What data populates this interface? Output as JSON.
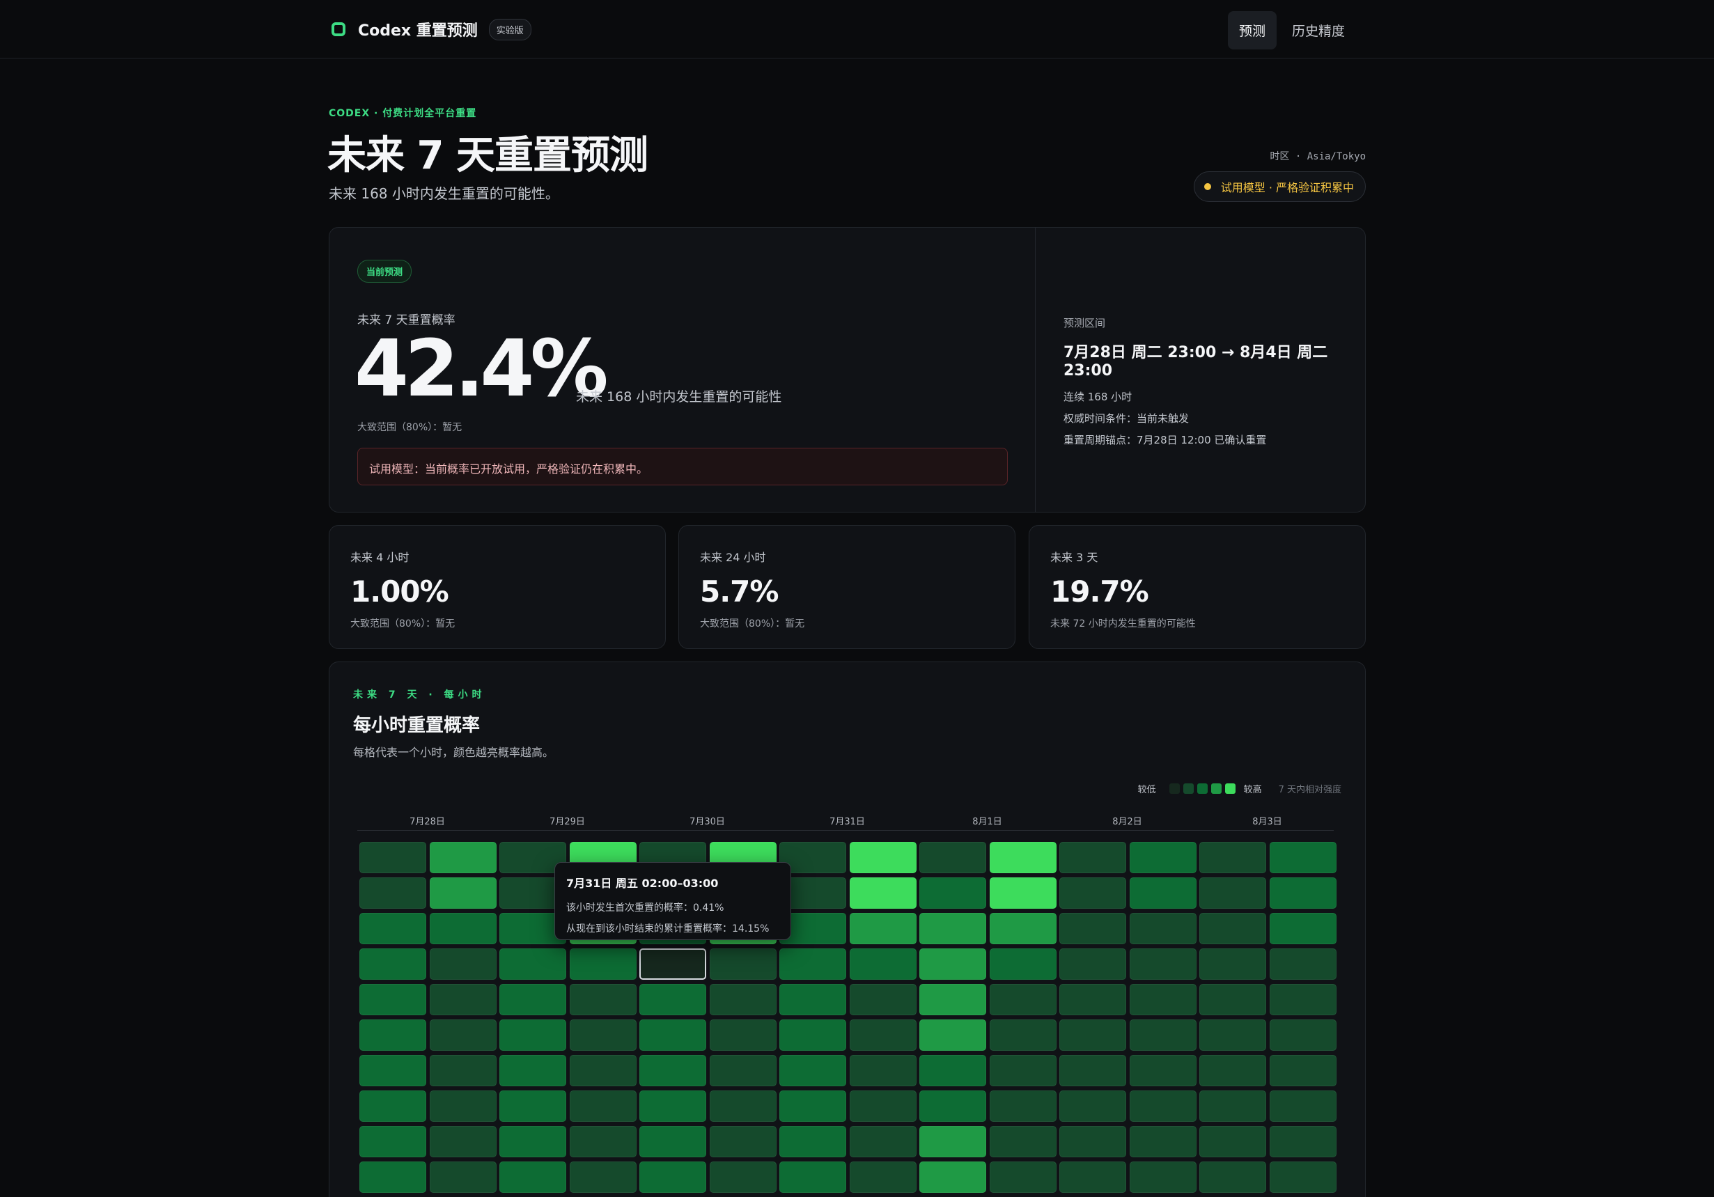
{
  "nav": {
    "brand": "Codex 重置预测",
    "badge": "实验版",
    "links": [
      "预测",
      "历史精度"
    ]
  },
  "header": {
    "eyebrow": "CODEX · 付费计划全平台重置",
    "title": "未来 7 天重置预测",
    "subtitle": "未来 168 小时内发生重置的可能性。",
    "timezone": "时区 · Asia/Tokyo",
    "status": "试用模型 · 严格验证积累中"
  },
  "main": {
    "tag": "当前预测",
    "label": "未来 7 天重置概率",
    "value": "42.4%",
    "note": "未来 168 小时内发生重置的可能性",
    "range": "大致范围（80%）：暂无",
    "warning": "试用模型：当前概率已开放试用，严格验证仍在积累中。",
    "side": {
      "label": "预测区间",
      "range": "7月28日 周二 23:00 → 8月4日 周二 23:00",
      "duration": "连续 168 小时",
      "condition": "权威时间条件：当前未触发",
      "anchor": "重置周期锚点：7月28日 12:00 已确认重置"
    }
  },
  "minis": [
    {
      "label": "未来 4 小时",
      "value": "1.00%",
      "note": "大致范围（80%）：暂无"
    },
    {
      "label": "未来 24 小时",
      "value": "5.7%",
      "note": "大致范围（80%）：暂无"
    },
    {
      "label": "未来 3 天",
      "value": "19.7%",
      "note": "未来 72 小时内发生重置的可能性"
    }
  ],
  "heatmap": {
    "eyebrow": "未来 7 天 · 每小时",
    "title": "每小时重置概率",
    "subtitle": "每格代表一个小时，颜色越亮概率越高。",
    "legend_low": "较低",
    "legend_high": "较高",
    "legend_note": "7 天内相对强度",
    "legend_colors": [
      "#16281e",
      "#154a2c",
      "#0d6c34",
      "#1f9a45",
      "#3ddc5c"
    ],
    "days": [
      "7月28日",
      "7月29日",
      "7月30日",
      "7月31日",
      "8月1日",
      "8月2日",
      "8月3日"
    ],
    "levels": [
      [
        1,
        3,
        1,
        4,
        1,
        4,
        1,
        4,
        1,
        4,
        1,
        2,
        1,
        2
      ],
      [
        1,
        3,
        1,
        4,
        1,
        4,
        1,
        4,
        2,
        4,
        1,
        2,
        1,
        2
      ],
      [
        2,
        2,
        2,
        4,
        2,
        4,
        2,
        3,
        3,
        3,
        1,
        1,
        1,
        2
      ],
      [
        2,
        1,
        2,
        2,
        0,
        1,
        2,
        2,
        3,
        2,
        1,
        1,
        1,
        1
      ],
      [
        2,
        1,
        2,
        1,
        2,
        1,
        2,
        1,
        3,
        1,
        1,
        1,
        1,
        1
      ],
      [
        2,
        1,
        2,
        1,
        2,
        1,
        2,
        1,
        3,
        1,
        1,
        1,
        1,
        1
      ],
      [
        2,
        1,
        2,
        1,
        2,
        1,
        2,
        1,
        2,
        1,
        1,
        1,
        1,
        1
      ],
      [
        2,
        1,
        2,
        1,
        2,
        1,
        2,
        1,
        2,
        1,
        1,
        1,
        1,
        1
      ],
      [
        2,
        1,
        2,
        1,
        2,
        1,
        2,
        1,
        3,
        1,
        1,
        1,
        1,
        1
      ],
      [
        2,
        1,
        2,
        1,
        2,
        1,
        2,
        1,
        3,
        1,
        1,
        1,
        1,
        1
      ]
    ],
    "selected_cell": {
      "row": 3,
      "col": 4
    },
    "tooltip": {
      "title": "7月31日 周五 02:00–03:00",
      "line1": "该小时发生首次重置的概率：0.41%",
      "line2": "从现在到该小时结束的累计重置概率：14.15%"
    }
  }
}
